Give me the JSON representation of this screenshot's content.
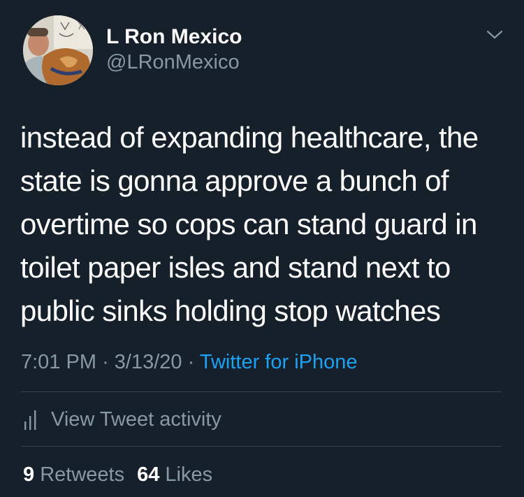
{
  "author": {
    "display_name": "L Ron Mexico",
    "handle": "@LRonMexico"
  },
  "tweet": {
    "lines": [
      "instead of expanding healthcare, the",
      "state is gonna approve a bunch of",
      "overtime so cops can stand guard in",
      "toilet paper isles and stand next to",
      "public sinks holding stop watches"
    ],
    "time": "7:01 PM",
    "date": "3/13/20",
    "separator": "·",
    "source": "Twitter for iPhone"
  },
  "activity": {
    "label": "View Tweet activity",
    "icon": "bar-chart-icon"
  },
  "stats": {
    "retweets_count": "9",
    "retweets_label": "Retweets",
    "likes_count": "64",
    "likes_label": "Likes"
  },
  "menu": {
    "icon": "chevron-down-icon"
  },
  "colors": {
    "background": "#15202b",
    "primary_text": "#ffffff",
    "secondary_text": "#8899a6",
    "link": "#1da1f2",
    "divider": "#38444d"
  }
}
